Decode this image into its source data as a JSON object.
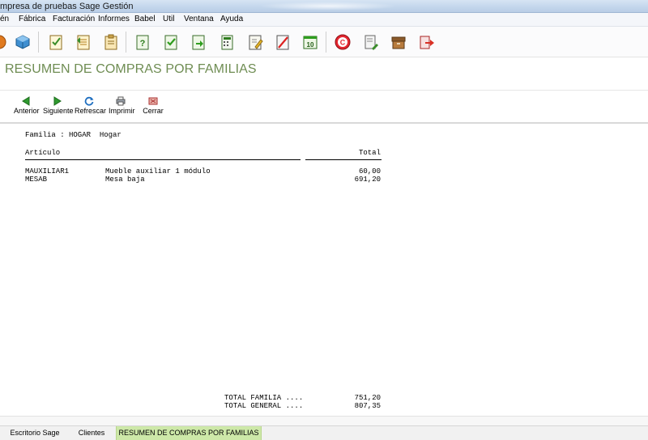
{
  "window": {
    "title": "mpresa de pruebas Sage Gestión"
  },
  "menu": [
    "én",
    "Fábrica",
    "Facturación",
    "Informes",
    "Babel",
    "Util",
    "Ventana",
    "Ayuda"
  ],
  "document": {
    "title": "RESUMEN DE COMPRAS POR FAMILIAS"
  },
  "subtoolbar": {
    "prev_label": "Anterior",
    "next_label": "Siguiente",
    "refresh_label": "Refrescar",
    "print_label": "Imprimir",
    "close_label": "Cerrar"
  },
  "report": {
    "family_line": "Familia : HOGAR  Hogar",
    "col_article": "Artículo",
    "col_total": "Total",
    "rows": [
      {
        "code": "MAUXILIAR1",
        "description": "Mueble auxiliar 1 módulo",
        "total": "60,00"
      },
      {
        "code": "MESAB",
        "description": "Mesa baja",
        "total": "691,20"
      }
    ],
    "total_family_label": "TOTAL FAMILIA ....",
    "total_family_value": "751,20",
    "total_general_label": "TOTAL GENERAL ....",
    "total_general_value": "807,35"
  },
  "tabs": [
    {
      "label": "Escritorio Sage",
      "active": false
    },
    {
      "label": "Clientes",
      "active": false
    },
    {
      "label": "RESUMEN DE COMPRAS POR FAMILIAS",
      "active": true
    }
  ],
  "colors": {
    "title_green": "#6f8d53",
    "active_tab": "#cde8a8"
  },
  "toolbar_icons": [
    "partial-icon",
    "cube-icon",
    "checklist-icon",
    "document-list-icon",
    "clipboard-icon",
    "question-doc-icon",
    "check-doc-icon",
    "export-doc-icon",
    "calculator-doc-icon",
    "edit-doc-icon",
    "cancel-doc-icon",
    "calendar-10-icon",
    "sage-c-icon",
    "report-doc-icon",
    "archive-box-icon",
    "exit-icon"
  ]
}
